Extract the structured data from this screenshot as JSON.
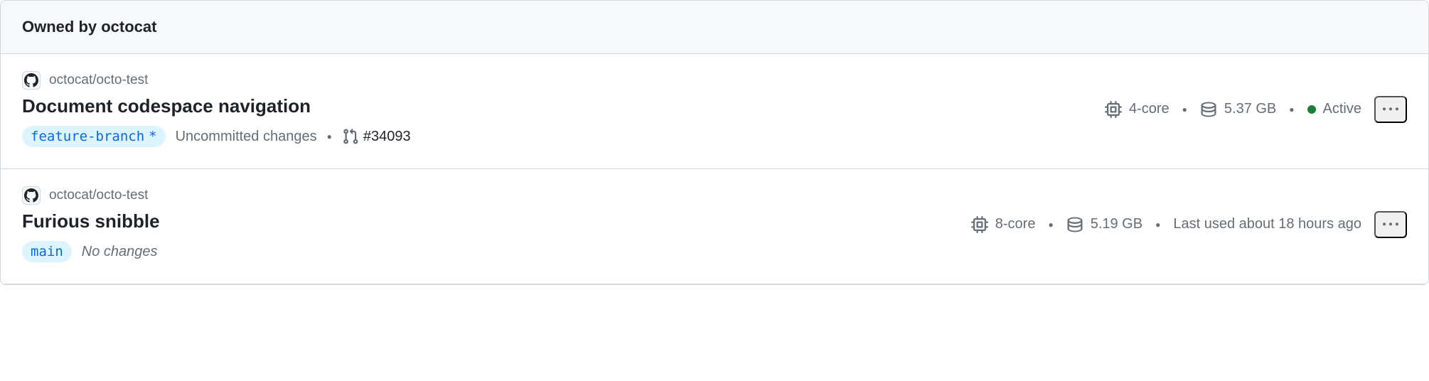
{
  "header": {
    "title": "Owned by octocat"
  },
  "codespaces": [
    {
      "repo": "octocat/octo-test",
      "name": "Document codespace navigation",
      "branch": "feature-branch",
      "branch_dirty": true,
      "changes": "Uncommitted changes",
      "changes_italic": false,
      "pr": "#34093",
      "cores": "4-core",
      "disk": "5.37 GB",
      "status": "Active",
      "status_active": true
    },
    {
      "repo": "octocat/octo-test",
      "name": "Furious snibble",
      "branch": "main",
      "branch_dirty": false,
      "changes": "No changes",
      "changes_italic": true,
      "pr": null,
      "cores": "8-core",
      "disk": "5.19 GB",
      "status": "Last used about 18 hours ago",
      "status_active": false
    }
  ]
}
